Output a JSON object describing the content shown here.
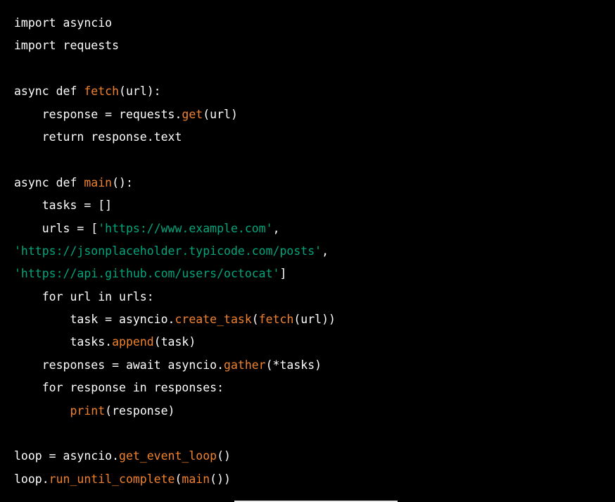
{
  "colors": {
    "background": "#000000",
    "plain": "#ffffff",
    "function": "#f0822e",
    "string": "#00a67d"
  },
  "code": {
    "lines": [
      [
        {
          "t": "import asyncio",
          "k": "plain"
        }
      ],
      [
        {
          "t": "import requests",
          "k": "plain"
        }
      ],
      [],
      [
        {
          "t": "async def ",
          "k": "plain"
        },
        {
          "t": "fetch",
          "k": "fn"
        },
        {
          "t": "(url):",
          "k": "plain"
        }
      ],
      [
        {
          "t": "    response = requests.",
          "k": "plain"
        },
        {
          "t": "get",
          "k": "fn"
        },
        {
          "t": "(url)",
          "k": "plain"
        }
      ],
      [
        {
          "t": "    return response.text",
          "k": "plain"
        }
      ],
      [],
      [
        {
          "t": "async def ",
          "k": "plain"
        },
        {
          "t": "main",
          "k": "fn"
        },
        {
          "t": "():",
          "k": "plain"
        }
      ],
      [
        {
          "t": "    tasks = []",
          "k": "plain"
        }
      ],
      [
        {
          "t": "    urls = [",
          "k": "plain"
        },
        {
          "t": "'https://www.example.com'",
          "k": "str"
        },
        {
          "t": ",",
          "k": "plain"
        }
      ],
      [
        {
          "t": "'https://jsonplaceholder.typicode.com/posts'",
          "k": "str"
        },
        {
          "t": ",",
          "k": "plain"
        }
      ],
      [
        {
          "t": "'https://api.github.com/users/octocat'",
          "k": "str"
        },
        {
          "t": "]",
          "k": "plain"
        }
      ],
      [
        {
          "t": "    for url in urls:",
          "k": "plain"
        }
      ],
      [
        {
          "t": "        task = asyncio.",
          "k": "plain"
        },
        {
          "t": "create_task",
          "k": "fn"
        },
        {
          "t": "(",
          "k": "plain"
        },
        {
          "t": "fetch",
          "k": "fn"
        },
        {
          "t": "(url))",
          "k": "plain"
        }
      ],
      [
        {
          "t": "        tasks.",
          "k": "plain"
        },
        {
          "t": "append",
          "k": "fn"
        },
        {
          "t": "(task)",
          "k": "plain"
        }
      ],
      [
        {
          "t": "    responses = await asyncio.",
          "k": "plain"
        },
        {
          "t": "gather",
          "k": "fn"
        },
        {
          "t": "(*tasks)",
          "k": "plain"
        }
      ],
      [
        {
          "t": "    for response in responses:",
          "k": "plain"
        }
      ],
      [
        {
          "t": "        ",
          "k": "plain"
        },
        {
          "t": "print",
          "k": "fn"
        },
        {
          "t": "(response)",
          "k": "plain"
        }
      ],
      [],
      [
        {
          "t": "loop = asyncio.",
          "k": "plain"
        },
        {
          "t": "get_event_loop",
          "k": "fn"
        },
        {
          "t": "()",
          "k": "plain"
        }
      ],
      [
        {
          "t": "loop.",
          "k": "plain"
        },
        {
          "t": "run_until_complete",
          "k": "fn"
        },
        {
          "t": "(",
          "k": "plain"
        },
        {
          "t": "main",
          "k": "fn"
        },
        {
          "t": "())",
          "k": "plain"
        }
      ]
    ]
  }
}
